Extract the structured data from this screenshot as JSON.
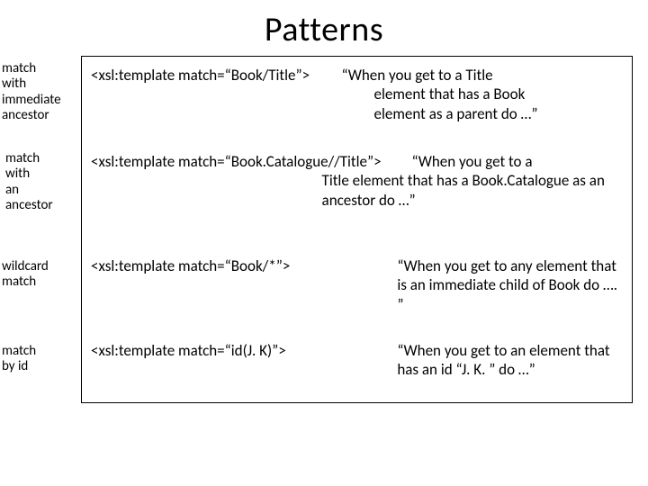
{
  "title": "Patterns",
  "labels": {
    "l1": {
      "w1": "match",
      "w2": "with",
      "w3": "immediate",
      "w4": "ancestor"
    },
    "l2": {
      "w1": "match",
      "w2": "with",
      "w3": "an",
      "w4": "ancestor"
    },
    "l3": {
      "w1": "wildcard",
      "w2": "match"
    },
    "l4": {
      "w1": "match",
      "w2": "by id"
    }
  },
  "rows": {
    "r1": {
      "code": "<xsl:template match=“Book/Title”>",
      "desc_l1": "“When you get to a Title",
      "desc_l2": "element that has a Book",
      "desc_l3": "element as a parent do …”"
    },
    "r2": {
      "code": "<xsl:template match=“Book.Catalogue//Title”>",
      "desc_l1": "“When you get to a",
      "desc_rest": "Title element that has a Book.Catalogue as an ancestor do …”"
    },
    "r3": {
      "code": "<xsl:template match=“Book/*”>",
      "desc": "“When you get to any element that is an immediate child of Book do …. ”"
    },
    "r4": {
      "code": "<xsl:template match=“id(J. K)”>",
      "desc": "“When you get to an element that has an id “J. K. ” do …”"
    }
  }
}
